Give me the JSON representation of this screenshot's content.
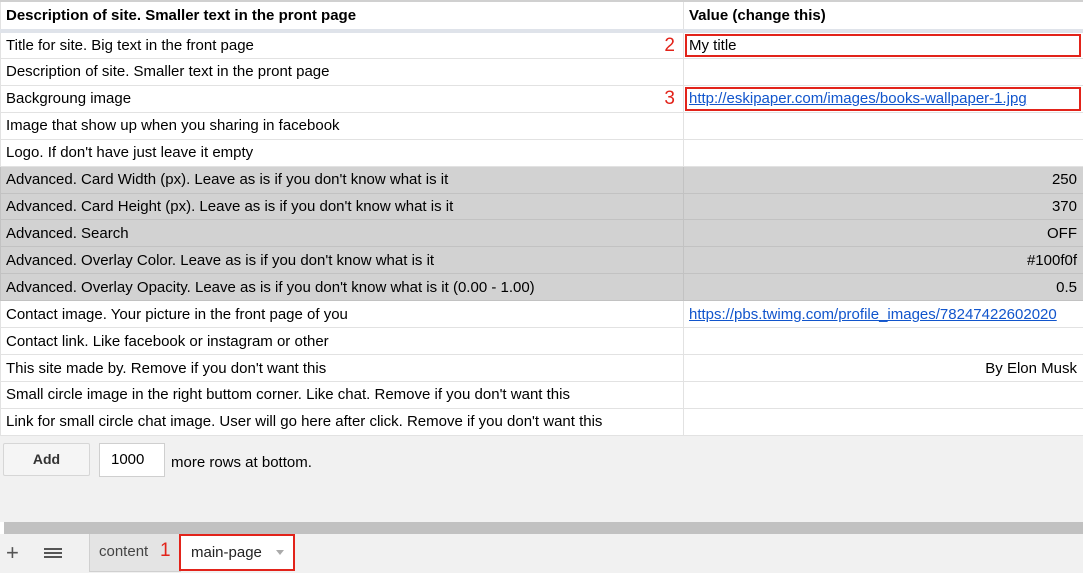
{
  "header": {
    "description": "Description of site. Smaller text in the pront page",
    "value": "Value (change this)"
  },
  "rows": [
    {
      "label": "Title for site. Big text in the front page",
      "value": "My title",
      "annotation": "2"
    },
    {
      "label": "Description of site. Smaller text in the pront page",
      "value": ""
    },
    {
      "label": "Backgroung image",
      "value": "http://eskipaper.com/images/books-wallpaper-1.jpg",
      "annotation": "3"
    },
    {
      "label": "Image that show up when you sharing in facebook",
      "value": ""
    },
    {
      "label": "Logo. If don't have just leave it empty",
      "value": ""
    },
    {
      "label": "Advanced. Card Width (px). Leave as is if you don't know what is it",
      "value": "250"
    },
    {
      "label": "Advanced. Card Height (px). Leave as is if you don't know what is it",
      "value": "370"
    },
    {
      "label": "Advanced. Search",
      "value": "OFF"
    },
    {
      "label": "Advanced. Overlay Color. Leave as is if you don't know what is it",
      "value": "#100f0f"
    },
    {
      "label": "Advanced. Overlay Opacity. Leave as is if you don't know what is it (0.00 - 1.00)",
      "value": "0.5"
    },
    {
      "label": "Contact image. Your picture in the front page of you",
      "value": "https://pbs.twimg.com/profile_images/78247422602020"
    },
    {
      "label": "Contact link. Like facebook or instagram or other",
      "value": ""
    },
    {
      "label": "This site made by. Remove if you don't want this",
      "value": "By Elon Musk"
    },
    {
      "label": "Small circle image in the right buttom corner. Like chat. Remove if you don't want this",
      "value": ""
    },
    {
      "label": "Link for small circle chat image. User will go here after click. Remove if you don't want this",
      "value": ""
    }
  ],
  "add_rows": {
    "button_label": "Add",
    "count": "1000",
    "suffix": "more rows at bottom."
  },
  "tabs": {
    "add_icon": "plus-icon",
    "list_icon": "list-icon",
    "items": [
      {
        "label": "content"
      },
      {
        "label": "main-page"
      }
    ],
    "annotation": "1"
  },
  "colors": {
    "highlight": "#e2231a",
    "advanced_row_bg": "#d2d2d2",
    "link": "#1155cc"
  }
}
